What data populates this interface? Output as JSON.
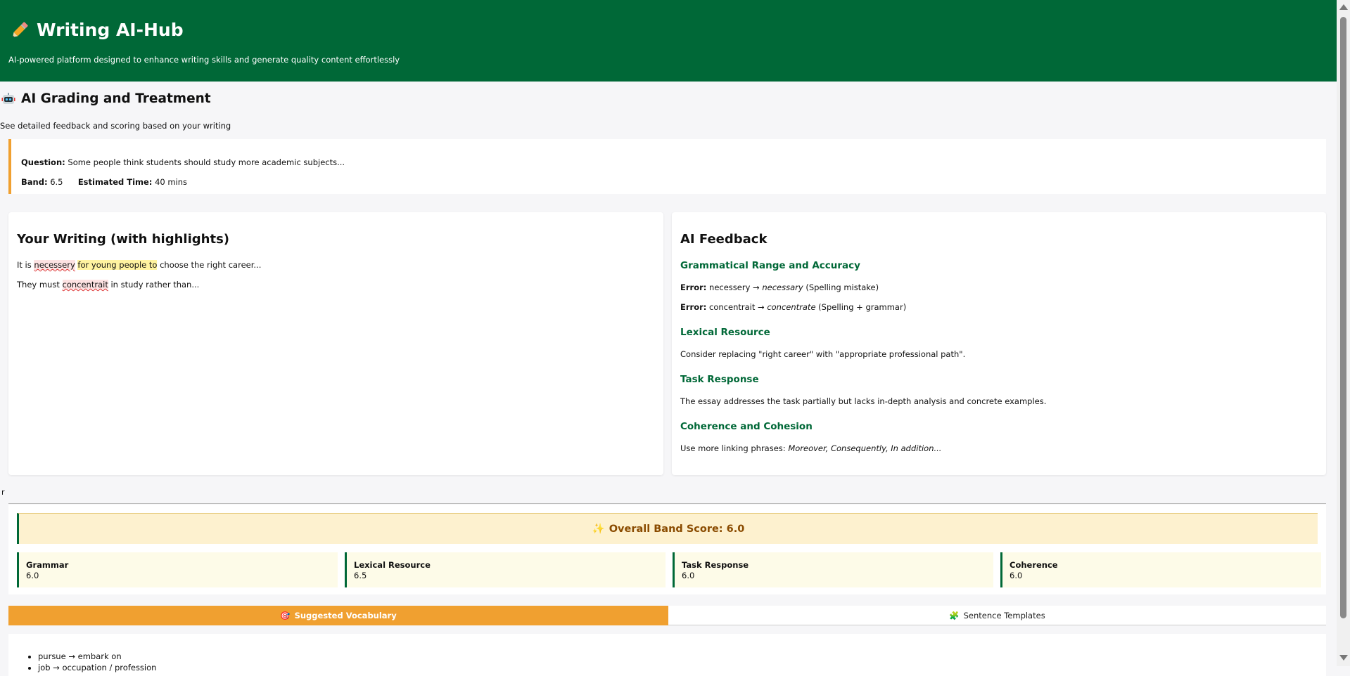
{
  "header": {
    "title": "Writing AI-Hub",
    "subtitle": "AI-powered platform designed to enhance writing skills and generate quality content effortlessly",
    "icon": "pencil-icon"
  },
  "section": {
    "title": "AI Grading and Treatment",
    "subtitle": "See detailed feedback and scoring based on your writing",
    "icon": "robot-icon"
  },
  "question": {
    "question_label": "Question:",
    "question_text": "Some people think students should study more academic subjects...",
    "band_label": "Band:",
    "band_value": "6.5",
    "time_label": "Estimated Time:",
    "time_value": "40 mins"
  },
  "writing": {
    "title": "Your Writing (with highlights)",
    "line1": {
      "pre": "It is ",
      "error": "necessery",
      "space": " ",
      "highlight": "for young people to",
      "post": " choose the right career..."
    },
    "line2": {
      "pre": "They must ",
      "error": "concentrait",
      "post": " in study rather than..."
    }
  },
  "feedback": {
    "title": "AI Feedback",
    "grammar": {
      "heading": "Grammatical Range and Accuracy",
      "errors": [
        {
          "label": "Error:",
          "wrong": "necessery",
          "arrow": "→",
          "right": "necessary",
          "note": "(Spelling mistake)"
        },
        {
          "label": "Error:",
          "wrong": "concentrait",
          "arrow": "→",
          "right": "concentrate",
          "note": "(Spelling + grammar)"
        }
      ]
    },
    "lexical": {
      "heading": "Lexical Resource",
      "text": "Consider replacing \"right career\" with \"appropriate professional path\"."
    },
    "task": {
      "heading": "Task Response",
      "text": "The essay addresses the task partially but lacks in-depth analysis and concrete examples."
    },
    "coherence": {
      "heading": "Coherence and Cohesion",
      "text_pre": "Use more linking phrases: ",
      "text_em": "Moreover, Consequently, In addition..."
    }
  },
  "stray_text": "r",
  "score": {
    "overall_icon": "✨",
    "overall_label": "Overall Band Score: 6.0",
    "criteria": [
      {
        "name": "Grammar",
        "value": "6.0"
      },
      {
        "name": "Lexical Resource",
        "value": "6.5"
      },
      {
        "name": "Task Response",
        "value": "6.0"
      },
      {
        "name": "Coherence",
        "value": "6.0"
      }
    ]
  },
  "tabs": {
    "vocab_icon": "🎯",
    "vocab_label": "Suggested Vocabulary",
    "templates_icon": "🧩",
    "templates_label": "Sentence Templates"
  },
  "vocab": {
    "items": [
      "pursue → embark on",
      "job → occupation / profession"
    ]
  },
  "colors": {
    "brand_green": "#006837",
    "accent_orange": "#f0a030",
    "score_bg": "#fdf1cf",
    "error_red": "#d33",
    "highlight_yellow": "#fff3a0"
  }
}
